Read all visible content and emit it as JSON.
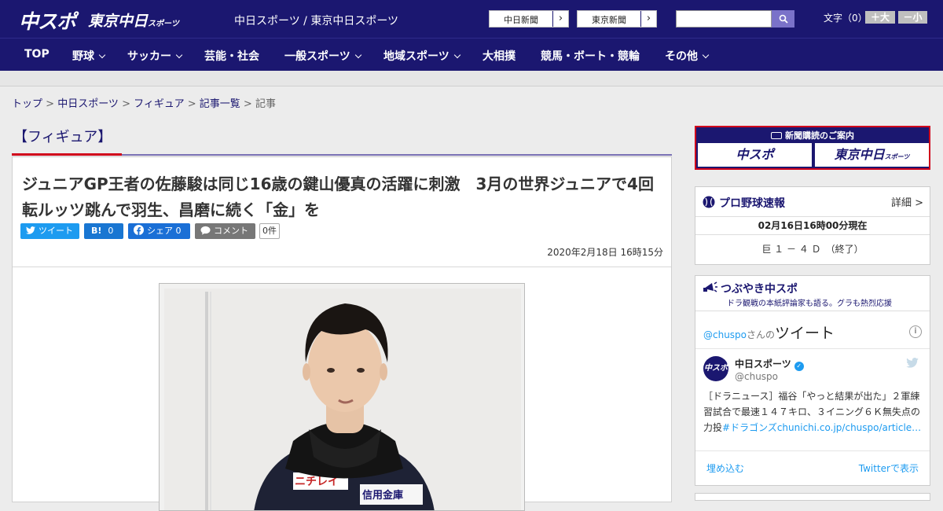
{
  "header": {
    "logo_chuspo": "中スポ",
    "logo_tokyo": "東京中日",
    "logo_tokyo_sub": "スポーツ",
    "site_names": "中日スポーツ / 東京中日スポーツ",
    "newspaper_buttons": [
      {
        "label": "中日新聞"
      },
      {
        "label": "東京新聞"
      }
    ],
    "search": {
      "placeholder": ""
    },
    "font_label": "文字（0）",
    "font_plus": "＋大",
    "font_minus": "－小"
  },
  "nav": {
    "items": [
      {
        "label": "TOP",
        "dropdown": false
      },
      {
        "label": "野球",
        "dropdown": true
      },
      {
        "label": "サッカー",
        "dropdown": true
      },
      {
        "label": "芸能・社会",
        "dropdown": false
      },
      {
        "label": "一般スポーツ",
        "dropdown": true
      },
      {
        "label": "地域スポーツ",
        "dropdown": true
      },
      {
        "label": "大相撲",
        "dropdown": false
      },
      {
        "label": "競馬・ボート・競輪",
        "dropdown": false
      },
      {
        "label": "その他",
        "dropdown": true
      }
    ]
  },
  "breadcrumb": {
    "items": [
      "トップ",
      "中日スポーツ",
      "フィギュア",
      "記事一覧"
    ],
    "sep": " > ",
    "current": "記事"
  },
  "article": {
    "category": "【フィギュア】",
    "headline": "ジュニアGP王者の佐藤駿は同じ16歳の鍵山優真の活躍に刺激　3月の世界ジュニアで4回転ルッツ跳んで羽生、昌磨に続く「金」を",
    "share": {
      "tweet": "ツイート",
      "hatena_mark": "B!",
      "hatena_count": "0",
      "facebook": "シェア",
      "facebook_count": "0",
      "comment": "コメント",
      "comment_count": "0件"
    },
    "date": "2020年2月18日 16時15分",
    "photo_text": "ニチレイ",
    "photo_text2": "信用金庫"
  },
  "sidebar": {
    "subscribe": {
      "title": "新聞購読のご案内",
      "logo1": "中スポ",
      "logo2": "東京中日",
      "logo2_sub": "スポーツ"
    },
    "baseball": {
      "title": "プロ野球速報",
      "detail": "詳細 >",
      "time": "02月16日16時00分現在",
      "score": "巨 １ － ４ Ｄ　（終了）"
    },
    "tsubuyaki": {
      "title": "つぶやき中スポ",
      "subtitle": "ドラ観戦の本紙評論家も語る。グラも熱烈応援",
      "handle_prefix": "@chuspo",
      "handle_suffix": "さんの",
      "tweets_word": "ツイート",
      "info": "i",
      "user_name": "中日スポーツ",
      "user_handle": "@chuspo",
      "avatar": "中スポ",
      "tweet_text": "［ドラニュース］福谷「やっと結果が出た」２軍練習試合で最速１４７キロ、３イニング６Ｋ無失点の力投",
      "tweet_link": "#ドラゴンズchunichi.co.jp/chuspo/article…",
      "embed": "埋め込む",
      "view_on": "Twitterで表示"
    }
  },
  "colors": {
    "brand_navy": "#1b1770",
    "accent_red": "#d0021b",
    "twitter_blue": "#1d9bf0"
  }
}
